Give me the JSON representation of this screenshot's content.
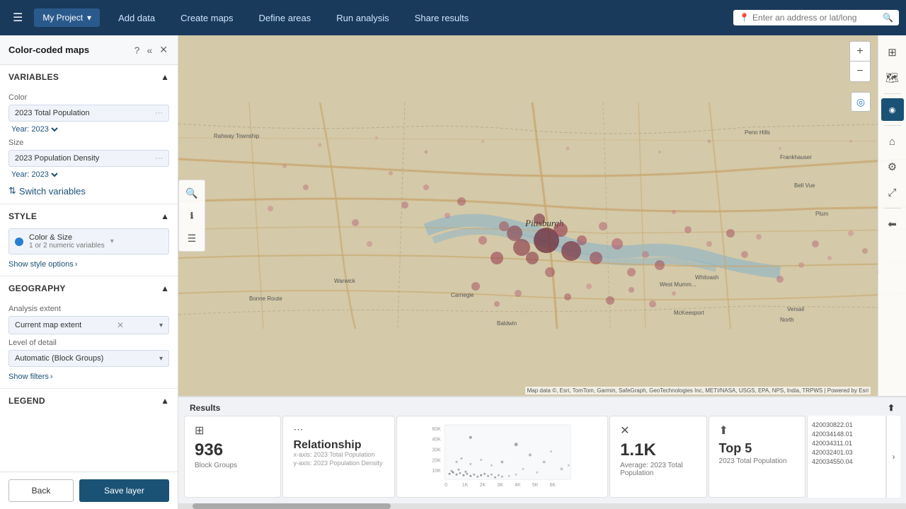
{
  "topbar": {
    "menu_icon": "☰",
    "project_name": "My Project",
    "project_chevron": "▾",
    "nav_items": [
      {
        "label": "Add data",
        "id": "add-data"
      },
      {
        "label": "Create maps",
        "id": "create-maps"
      },
      {
        "label": "Define areas",
        "id": "define-areas"
      },
      {
        "label": "Run analysis",
        "id": "run-analysis"
      },
      {
        "label": "Share results",
        "id": "share-results"
      }
    ],
    "search_placeholder": "Enter an address or lat/long",
    "search_icon": "🔍"
  },
  "left_panel": {
    "title": "Color-coded maps",
    "help_icon": "?",
    "collapse_icon": "«",
    "close_icon": "✕",
    "variables_section": {
      "label": "Variables",
      "color_label": "Color",
      "color_field": "2023 Total Population",
      "color_year": "Year: 2023",
      "size_label": "Size",
      "size_field": "2023 Population Density",
      "size_year": "Year: 2023",
      "switch_label": "Switch variables"
    },
    "style_section": {
      "label": "Style",
      "option_label": "Color & Size",
      "option_sub": "1 or 2 numeric variables",
      "show_style_label": "Show style options"
    },
    "geography_section": {
      "label": "Geography",
      "analysis_extent_label": "Analysis extent",
      "analysis_extent_value": "Current map extent",
      "detail_label": "Level of detail",
      "detail_value": "Automatic (Block Groups)",
      "show_filters_label": "Show filters"
    },
    "legend_section": {
      "label": "Legend"
    },
    "back_button": "Back",
    "save_button": "Save layer"
  },
  "results": {
    "header": "Results",
    "cards": [
      {
        "icon": "⊞",
        "value": "936",
        "label": "Block Groups",
        "type": "count"
      },
      {
        "icon": "≈",
        "title": "Relationship",
        "x_axis": "x-axis: 2023 Total Population",
        "y_axis": "y-axis: 2023 Population Density",
        "type": "relationship"
      },
      {
        "type": "chart",
        "y_labels": [
          "60K",
          "40K",
          "30K",
          "20K",
          "10K"
        ],
        "x_labels": [
          "0",
          "1K",
          "2K",
          "3K",
          "4K",
          "5K",
          "6K"
        ]
      },
      {
        "icon": "✕",
        "value": "1.1K",
        "label": "Average: 2023 Total Population",
        "type": "stat"
      },
      {
        "icon": "⬆",
        "title": "Top 5",
        "label": "2023 Total Population",
        "type": "top5"
      }
    ],
    "far_right_ids": [
      "420030822.01",
      "420034148.01",
      "420034311.01",
      "420032401.03",
      "420034550.04"
    ]
  },
  "map": {
    "attribution": "Map data ©, Esri, TomTom, Garmin, SafeGraph, GeoTechnologies Inc, METI/NASA, USGS, EPA, NPS, India, TRPWS | Powered by Esri"
  }
}
